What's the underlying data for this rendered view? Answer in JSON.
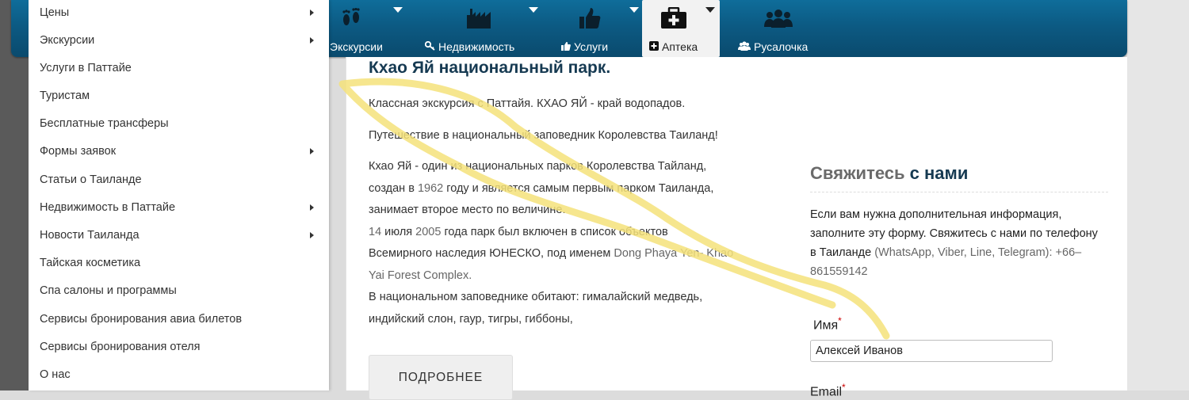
{
  "navbar": {
    "items": [
      {
        "label": "Экскурсии",
        "icon": "footprints-icon"
      },
      {
        "label": "Недвижимость",
        "icon": "factory-icon",
        "label_icon": "key-icon"
      },
      {
        "label": "Услуги",
        "icon": "thumbs-up-icon",
        "label_icon": "thumbs-up-icon"
      },
      {
        "label": "Аптека",
        "icon": "first-aid-kit-icon",
        "label_icon": "plus-square-icon",
        "active": true
      },
      {
        "label": "Русалочка",
        "icon": "users-icon",
        "label_icon": "users-icon"
      }
    ]
  },
  "menu": {
    "items": [
      {
        "label": "Цены",
        "has_submenu": true
      },
      {
        "label": "Экскурсии",
        "has_submenu": true
      },
      {
        "label": "Услуги в Паттайе",
        "has_submenu": false
      },
      {
        "label": "Туристам",
        "has_submenu": false
      },
      {
        "label": "Бесплатные трансферы",
        "has_submenu": false
      },
      {
        "label": "Формы заявок",
        "has_submenu": true
      },
      {
        "label": "Статьи о Таиланде",
        "has_submenu": false
      },
      {
        "label": "Недвижимость в Паттайе",
        "has_submenu": true
      },
      {
        "label": "Новости Таиланда",
        "has_submenu": true
      },
      {
        "label": "Тайская косметика",
        "has_submenu": false
      },
      {
        "label": "Спа салоны и программы",
        "has_submenu": false
      },
      {
        "label": "Сервисы бронирования авиа билетов",
        "has_submenu": false
      },
      {
        "label": "Сервисы бронирования отеля",
        "has_submenu": false
      },
      {
        "label": "О нас",
        "has_submenu": false
      }
    ]
  },
  "article": {
    "title": "Кхао Яй национальный парк.",
    "p1": "Классная экскурсия с Паттайя. КХАО ЯЙ - край водопадов.",
    "p2": "Путешествие в национальный заповедник Королевства Таиланд!",
    "p3_l1": "Кхао Яй - один из национальных парков Королевства Тайланд,",
    "p3_l2a": "создан в ",
    "p3_year1": "1962",
    "p3_l2b": " году и является самым первым парком Таиланда,",
    "p3_l3": "занимает второе место по величине.",
    "p3_date_a": "14",
    "p3_l4a": " июля ",
    "p3_date_b": "2005",
    "p3_l4b": " года парк был включен в список объектов",
    "p3_l5a": "Всемирного наследия ЮНЕСКО, под именем ",
    "p3_latin1": "Dong Phaya Yen- Khao",
    "p3_latin2": "Yai Forest Complex.",
    "p3_l7": "В национальном заповеднике обитают: гималайский медведь,",
    "p3_l8": "индийский слон, гаур, тигры, гиббоны,",
    "more_label": "ПОДРОБНЕЕ"
  },
  "contact": {
    "title_a": "Свяжитесь",
    "title_b": " с нами",
    "text_a": "Если вам нужна дополнительная информация, заполните эту форму. Свяжитесь с нами по телефону в Таиланде ",
    "text_b": "(WhatsApp, Viber, Line, Telegram):",
    "text_c": " +66–861559142",
    "name_label": "Имя",
    "required_mark": "*",
    "name_value": "Алексей Иванов",
    "email_label": "Email"
  },
  "colors": {
    "navbar": "#0c5a83",
    "title": "#163a52",
    "highlight": "#f5e27a"
  }
}
